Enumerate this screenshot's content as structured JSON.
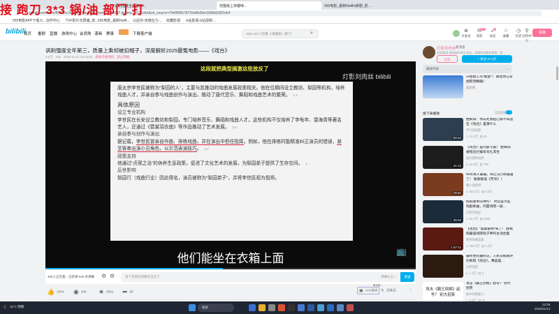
{
  "overlay_text": "接 跑刀 3*3 锅/油 部门 打",
  "browser": {
    "tabs": [
      "讽刺强度全年第三…",
      "完整版上单趣味…",
      "555电影_最新Netflix新剧_影…"
    ],
    "url": "bilibili.com/video/BV1Vsc1E8Xb8/?spm_id_from=333.1007.tianma.2-2-5.click&vd_source=74d95f6678725e8bd0ec905bb5302eb4",
    "bookmarks": [
      "555电影APP下载-5...",
      "创作中心",
      "TVF影片无限播_高...",
      "555电影_最新Netfl...",
      "以后你-米德在力-...",
      "收藏影视",
      "-b站影视-b站视频-..."
    ]
  },
  "header": {
    "logo": "bilibili",
    "nav": [
      "首页",
      "番剧",
      "直播",
      "游戏中心",
      "会员购",
      "漫画",
      "赛事",
      "下载客户端"
    ],
    "search_placeholder": "XDD 457人在看 人家都是一职了!",
    "icons": [
      {
        "label": "大会员",
        "icon": "vip-icon"
      },
      {
        "label": "消息",
        "icon": "message-icon",
        "badge": "99+"
      },
      {
        "label": "动态",
        "icon": "dynamic-icon",
        "badge": "5"
      },
      {
        "label": "收藏",
        "icon": "favorite-icon"
      },
      {
        "label": "历史",
        "icon": "history-icon"
      },
      {
        "label": "创作中心",
        "icon": "creator-icon"
      }
    ],
    "upload_label": "投稿"
  },
  "video": {
    "title": "讽刺强度全年第三，质量上乘却被扣帽子，深度解析2025最冤电影——《戏台》",
    "views": "6.5万",
    "danmaku": "645",
    "date": "2025-11-12 19:15:00",
    "copyright": "未经作者授权，禁止转载",
    "top_text": "这段就把典型搞激这些放反了",
    "watermark": "灯影刘肉丝 bilibili",
    "subtitle": "他们能坐在衣箱上面",
    "progress": 0.48,
    "slide": {
      "p1": "唐太宗李世民被称为“梨园的人”，主要与其推动的戏曲发展政策相关。他在位期间设立教坊、梨园等机构，培养戏曲人才，并亲自参与戏曲创作与演出，推动了唐代音乐、舞蹈和戏曲艺术的繁荣。",
      "p1_refs": "1  2",
      "h_main": "具体原因",
      "h1": "设立专业机构",
      "p2": "李世民在长安设立教坊和梨园，专门培养音乐、舞蹈和戏曲人才。这些机构不仅培养了李龟年、雷海青等著名艺人，还通过《霓裳羽衣曲》等作品推动了艺术发展。",
      "p2_refs": "3  4",
      "h2": "亲自参与创作与演出",
      "p3a": "据记载，",
      "p3b": "李世民曾亲自作曲、排练戏曲，并在演出中担任指挥",
      "p3c": "。例如，他在排练时能精准纠正演员的错误，",
      "p3d": "甚至客串出演小丑角色，以示范表演技巧",
      "p3e": "。",
      "p3_refs": "3  4",
      "h3": "政策支持",
      "p4": "他通过“贞观之治”的休养生息政策，促进了文化艺术的发展，为梨园弟子提供了生存空间。",
      "p4_refs": "1",
      "h4": "后世影响",
      "p5": "梨园行（戏曲行业）因此得名，演员被称为“梨园弟子”，并将李世民视为祖师。"
    }
  },
  "danmaku_bar": {
    "count_text": "455人正在看，已装填 645 条弹幕",
    "placeholder": "发个友善的弹幕见证当下",
    "etiquette": "弹幕礼仪 >",
    "send": "发送"
  },
  "actions": {
    "like": "2404",
    "coin": "939",
    "favorite": "5002",
    "share": "65",
    "ai_label": "AI小助手",
    "ai_badge": "新功能",
    "notes": "记笔记"
  },
  "uploader": {
    "name": "灯影刘肉丝",
    "message": "发消息",
    "desc": "拍戏表演 每周陪你淘金/淘宝，闲聊时光解析剪辑，是…",
    "charge": "充电",
    "follow": "+ 关注 27.2万"
  },
  "playlist": {
    "label": "播放列表",
    "item": {
      "title": "开始给工作“掘金”？ 静音你已拿捏职场精髓！",
      "author": "猫碰撞"
    }
  },
  "next": {
    "label": "接下来播放",
    "autoplay": "自动连播"
  },
  "recommend": [
    {
      "title": "胜枫阳：你去死我起心都不知道在《戏台》里演什么",
      "author": "平凡的电影",
      "views": "21.9万",
      "comments": "29",
      "duration": "00:42",
      "color": "#2c3e50"
    },
    {
      "title": "《戏台》是内部斗狠？ 胜枫阳被指出烂编号号扎浑合",
      "author": "张为唐四电影",
      "views": "44.6万",
      "comments": "790",
      "duration": "41:12",
      "color": "#1d1d1d"
    },
    {
      "title": "50年来人最骗，却让冯小刚骗喜了！ 独家解读《芳华》（",
      "author": "聊小电影吧",
      "views": "343.5万",
      "comments": "2.5万",
      "duration": "28:51",
      "color": "#7a3b1e"
    },
    {
      "title": "妈妈版本的神作！ 时空是大乱戏剧奏曲，内置戏院一般…",
      "author": "灯影刘肉丝",
      "views": "94.4万",
      "comments": "4300",
      "duration": "39:26",
      "color": "#1b2b3a"
    },
    {
      "title": "【戏台】“喜剧部啊”来了！ 胜枫阳最强戏院戏子神作台词合集",
      "author": "师师再看电影",
      "views": "760.5万",
      "comments": "4.3万",
      "duration": "1:57:11",
      "color": "#5a1a12"
    },
    {
      "title": "最终更的最好记，人民日报稿评价枫阳《戏台》，黄晶是…",
      "author": "大梦电影",
      "views": "1.1万",
      "comments": "3",
      "duration": "",
      "color": "#2a1a10"
    },
    {
      "title": "攻击《霸王别姬》起号？ 别大招笑",
      "author": "探中的两面儿",
      "views": "2.8万",
      "comments": "77",
      "duration": "",
      "color": "#ffffff",
      "thumb_text": "攻击《霸王别姬》起号？ 别大招笑"
    }
  ],
  "taskbar": {
    "weather": "15°C 晴朗",
    "search": "搜索",
    "time": "22:09",
    "date": "2025/11/14"
  }
}
